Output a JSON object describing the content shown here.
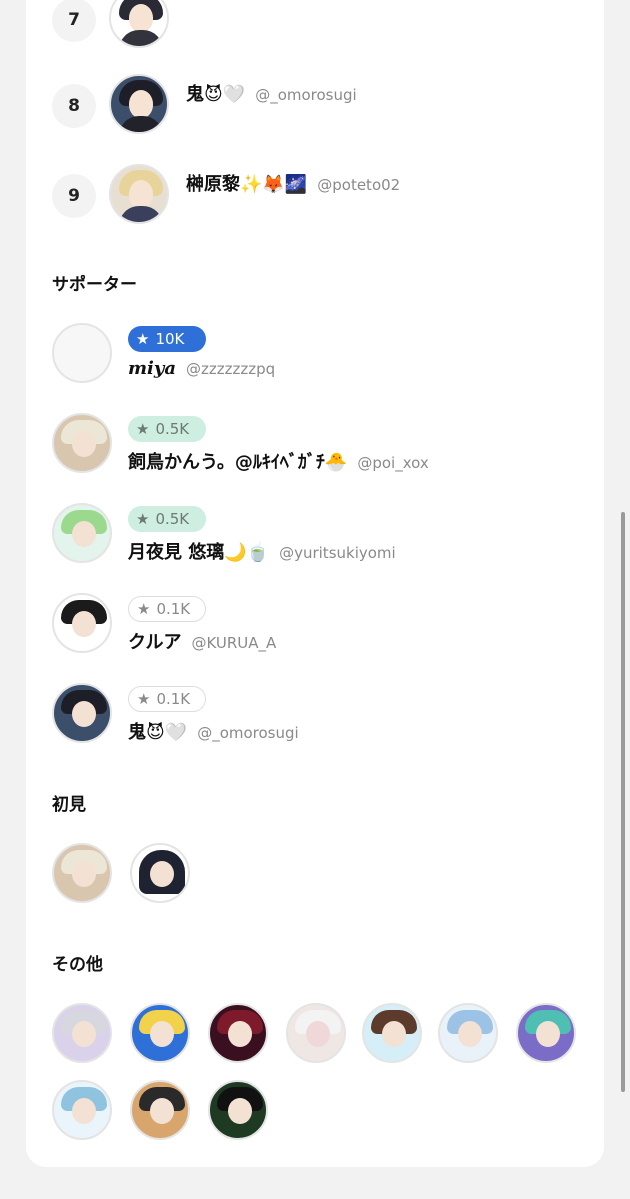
{
  "ranking": [
    {
      "rank": "7",
      "name": "",
      "handle": ""
    },
    {
      "rank": "8",
      "name": "鬼😈🤍",
      "handle": "@_omorosugi"
    },
    {
      "rank": "9",
      "name": "榊原黎✨🦊🌌",
      "handle": "@poteto02"
    }
  ],
  "supporters": {
    "title": "サポーター",
    "items": [
      {
        "badge": "10K",
        "name": "miya",
        "handle": "@zzzzzzzpq"
      },
      {
        "badge": "0.5K",
        "name": "飼鳥かんう。@ﾙｷｲﾍﾞｶﾞﾁ🐣",
        "handle": "@poi_xox"
      },
      {
        "badge": "0.5K",
        "name": "月夜見 悠璃🌙🍵",
        "handle": "@yuritsukiyomi"
      },
      {
        "badge": "0.1K",
        "name": "クルア",
        "handle": "@KURUA_A"
      },
      {
        "badge": "0.1K",
        "name": "鬼😈🤍",
        "handle": "@_omorosugi"
      }
    ]
  },
  "first_time": {
    "title": "初見"
  },
  "others": {
    "title": "その他"
  },
  "icons": {
    "star": "star-icon"
  },
  "colors": {
    "accent_blue": "#2f6fd8",
    "mint": "#cdeee0"
  }
}
